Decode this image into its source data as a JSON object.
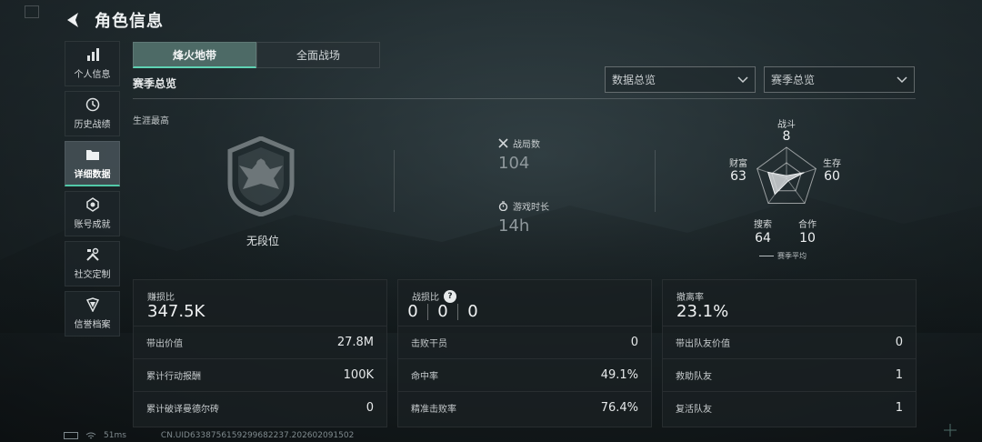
{
  "header": {
    "title": "角色信息"
  },
  "sidebar": {
    "items": [
      {
        "label": "个人信息",
        "icon": "bar-chart-icon",
        "active": false
      },
      {
        "label": "历史战绩",
        "icon": "clock-icon",
        "active": false
      },
      {
        "label": "详细数据",
        "icon": "folder-icon",
        "active": true
      },
      {
        "label": "账号成就",
        "icon": "medal-icon",
        "active": false
      },
      {
        "label": "社交定制",
        "icon": "tools-icon",
        "active": false
      },
      {
        "label": "信誉档案",
        "icon": "shield-icon",
        "active": false
      }
    ]
  },
  "tabs": [
    {
      "label": "烽火地带",
      "active": true
    },
    {
      "label": "全面战场",
      "active": false
    }
  ],
  "section": {
    "title": "赛季总览"
  },
  "dropdowns": {
    "data_view": "数据总览",
    "season": "赛季总览"
  },
  "career": {
    "label": "生涯最高",
    "rank": "无段位"
  },
  "stats": {
    "matches": {
      "label": "战局数",
      "value": "104"
    },
    "playtime": {
      "label": "游戏时长",
      "value": "14h"
    }
  },
  "radar": {
    "axes": [
      {
        "label": "战斗",
        "value": "8"
      },
      {
        "label": "生存",
        "value": "60"
      },
      {
        "label": "合作",
        "value": "10"
      },
      {
        "label": "搜索",
        "value": "64"
      },
      {
        "label": "财富",
        "value": "63"
      }
    ],
    "legend": "赛季平均"
  },
  "panels": {
    "profit": {
      "title": "赚损比",
      "value": "347.5K",
      "rows": [
        {
          "label": "带出价值",
          "value": "27.8M"
        },
        {
          "label": "累计行动报酬",
          "value": "100K"
        },
        {
          "label": "累计破译曼德尔砖",
          "value": "0"
        }
      ]
    },
    "combat": {
      "title": "战损比",
      "help": "?",
      "ratio": [
        "0",
        "0",
        "0"
      ],
      "rows": [
        {
          "label": "击败干员",
          "value": "0"
        },
        {
          "label": "命中率",
          "value": "49.1%"
        },
        {
          "label": "精准击败率",
          "value": "76.4%"
        }
      ]
    },
    "evac": {
      "title": "撤离率",
      "value": "23.1%",
      "rows": [
        {
          "label": "带出队友价值",
          "value": "0"
        },
        {
          "label": "救助队友",
          "value": "1"
        },
        {
          "label": "复活队友",
          "value": "1"
        }
      ]
    }
  },
  "footer": {
    "ping": "51ms",
    "uid": "CN.UID6338756159299682237.202602091502"
  },
  "colors": {
    "accent": "#52c9a8",
    "tab_active": "#4d6a66"
  }
}
